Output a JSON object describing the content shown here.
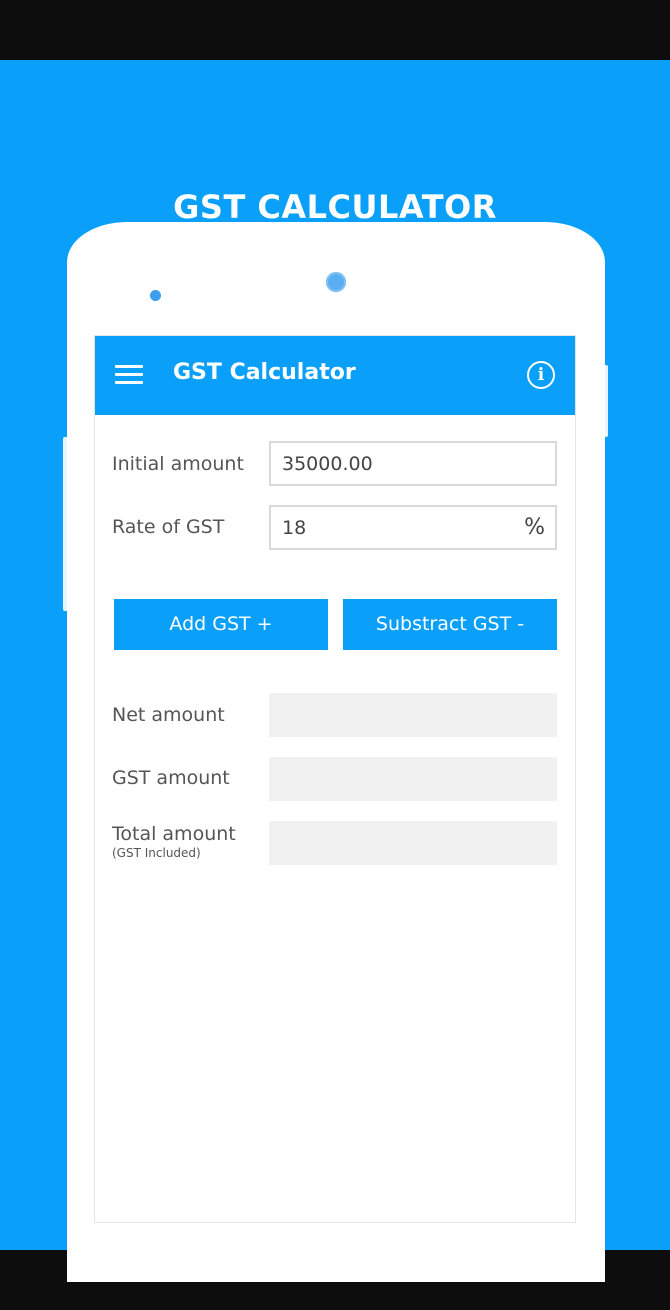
{
  "promo": {
    "title": "GST CALCULATOR"
  },
  "appbar": {
    "title": "GST Calculator",
    "menu_icon": "hamburger-menu-icon",
    "info_icon": "info-icon",
    "info_glyph": "i"
  },
  "form": {
    "initial_amount_label": "Initial amount",
    "initial_amount_value": "35000.00",
    "rate_label": "Rate of GST",
    "rate_value": "18",
    "rate_unit": "%"
  },
  "buttons": {
    "add_label": "Add GST +",
    "subtract_label": "Substract GST -"
  },
  "results": {
    "net_label": "Net amount",
    "gst_label": "GST amount",
    "total_label": "Total amount",
    "total_sublabel": "(GST Included)"
  },
  "colors": {
    "accent": "#0aa0f9",
    "background": "#0d0d0d",
    "field_border": "#d9d9d9",
    "output_bg": "#f1f1f1"
  }
}
